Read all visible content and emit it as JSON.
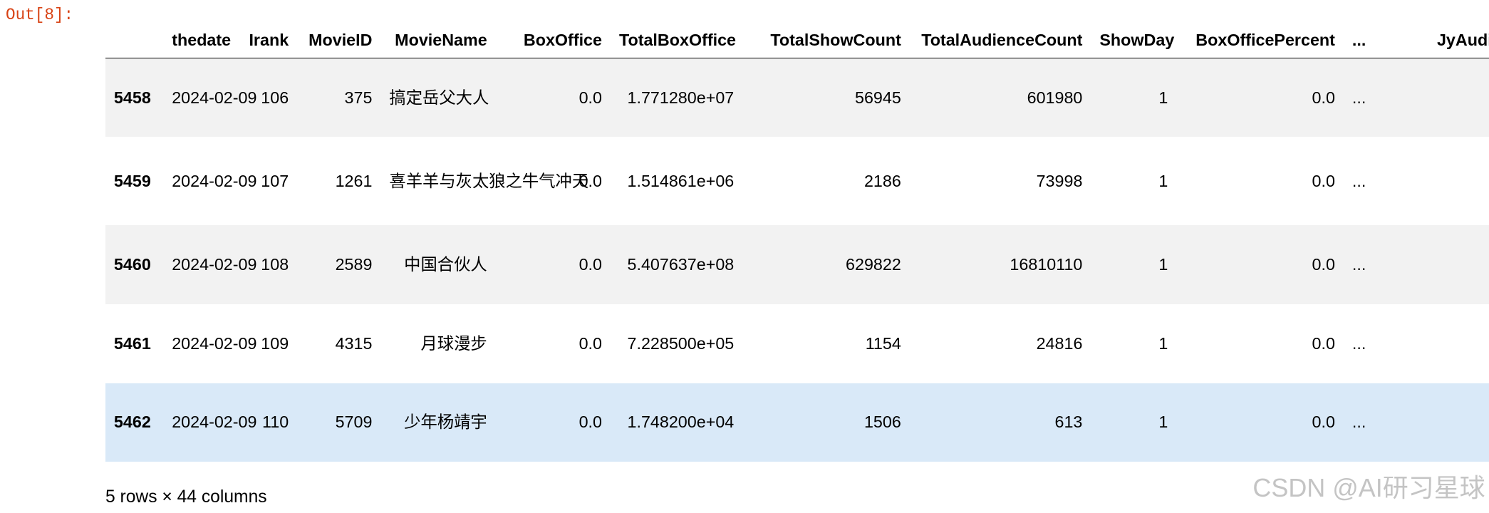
{
  "cell": {
    "prompt": "Out[8]:"
  },
  "table": {
    "columns": [
      "thedate",
      "Irank",
      "MovieID",
      "MovieName",
      "BoxOffice",
      "TotalBoxOffice",
      "TotalShowCount",
      "TotalAudienceCount",
      "ShowDay",
      "BoxOfficePercent",
      "...",
      "JyAudienceCount"
    ],
    "rows": [
      {
        "index": "5458",
        "thedate": "2024-02-09",
        "Irank": "106",
        "MovieID": "375",
        "MovieName": "搞定岳父大人",
        "BoxOffice": "0.0",
        "TotalBoxOffice": "1.771280e+07",
        "TotalShowCount": "56945",
        "TotalAudienceCount": "601980",
        "ShowDay": "1",
        "BoxOfficePercent": "0.0",
        "ellipsis": "..."
      },
      {
        "index": "5459",
        "thedate": "2024-02-09",
        "Irank": "107",
        "MovieID": "1261",
        "MovieName": "喜羊羊与灰太狼之牛气冲天",
        "BoxOffice": "0.0",
        "TotalBoxOffice": "1.514861e+06",
        "TotalShowCount": "2186",
        "TotalAudienceCount": "73998",
        "ShowDay": "1",
        "BoxOfficePercent": "0.0",
        "ellipsis": "..."
      },
      {
        "index": "5460",
        "thedate": "2024-02-09",
        "Irank": "108",
        "MovieID": "2589",
        "MovieName": "中国合伙人",
        "BoxOffice": "0.0",
        "TotalBoxOffice": "5.407637e+08",
        "TotalShowCount": "629822",
        "TotalAudienceCount": "16810110",
        "ShowDay": "1",
        "BoxOfficePercent": "0.0",
        "ellipsis": "..."
      },
      {
        "index": "5461",
        "thedate": "2024-02-09",
        "Irank": "109",
        "MovieID": "4315",
        "MovieName": "月球漫步",
        "BoxOffice": "0.0",
        "TotalBoxOffice": "7.228500e+05",
        "TotalShowCount": "1154",
        "TotalAudienceCount": "24816",
        "ShowDay": "1",
        "BoxOfficePercent": "0.0",
        "ellipsis": "..."
      },
      {
        "index": "5462",
        "thedate": "2024-02-09",
        "Irank": "110",
        "MovieID": "5709",
        "MovieName": "少年杨靖宇",
        "BoxOffice": "0.0",
        "TotalBoxOffice": "1.748200e+04",
        "TotalShowCount": "1506",
        "TotalAudienceCount": "613",
        "ShowDay": "1",
        "BoxOfficePercent": "0.0",
        "ellipsis": "..."
      }
    ],
    "shape_text": "5 rows × 44 columns"
  },
  "watermark": "CSDN @AI研习星球",
  "colors": {
    "prompt": "#d84315",
    "row_stripe": "#f2f2f2",
    "row_hover": "#d9e9f8"
  }
}
